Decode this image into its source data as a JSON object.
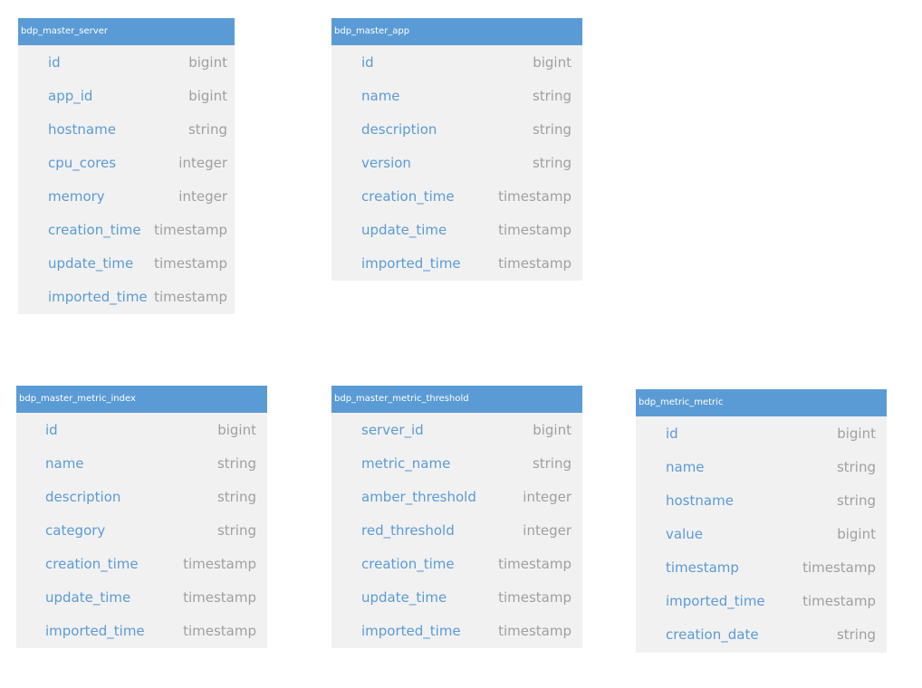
{
  "colors": {
    "header_bg": "#5b9bd5",
    "body_bg": "#f1f1f1",
    "column_name": "#5b9bd5",
    "column_type": "#a0a0a0"
  },
  "tables": [
    {
      "id": "t-server",
      "title": "bdp_master_server",
      "columns": [
        {
          "name": "id",
          "type": "bigint"
        },
        {
          "name": "app_id",
          "type": "bigint"
        },
        {
          "name": "hostname",
          "type": "string"
        },
        {
          "name": "cpu_cores",
          "type": "integer"
        },
        {
          "name": "memory",
          "type": "integer"
        },
        {
          "name": "creation_time",
          "type": "timestamp"
        },
        {
          "name": "update_time",
          "type": "timestamp"
        },
        {
          "name": "imported_time",
          "type": "timestamp"
        }
      ]
    },
    {
      "id": "t-app",
      "title": "bdp_master_app",
      "columns": [
        {
          "name": "id",
          "type": "bigint"
        },
        {
          "name": "name",
          "type": "string"
        },
        {
          "name": "description",
          "type": "string"
        },
        {
          "name": "version",
          "type": "string"
        },
        {
          "name": "creation_time",
          "type": "timestamp"
        },
        {
          "name": "update_time",
          "type": "timestamp"
        },
        {
          "name": "imported_time",
          "type": "timestamp"
        }
      ]
    },
    {
      "id": "t-metric-index",
      "title": "bdp_master_metric_index",
      "columns": [
        {
          "name": "id",
          "type": "bigint"
        },
        {
          "name": "name",
          "type": "string"
        },
        {
          "name": "description",
          "type": "string"
        },
        {
          "name": "category",
          "type": "string"
        },
        {
          "name": "creation_time",
          "type": "timestamp"
        },
        {
          "name": "update_time",
          "type": "timestamp"
        },
        {
          "name": "imported_time",
          "type": "timestamp"
        }
      ]
    },
    {
      "id": "t-threshold",
      "title": "bdp_master_metric_threshold",
      "columns": [
        {
          "name": "server_id",
          "type": "bigint"
        },
        {
          "name": "metric_name",
          "type": "string"
        },
        {
          "name": "amber_threshold",
          "type": "integer"
        },
        {
          "name": "red_threshold",
          "type": "integer"
        },
        {
          "name": "creation_time",
          "type": "timestamp"
        },
        {
          "name": "update_time",
          "type": "timestamp"
        },
        {
          "name": "imported_time",
          "type": "timestamp"
        }
      ]
    },
    {
      "id": "t-metric",
      "title": "bdp_metric_metric",
      "columns": [
        {
          "name": "id",
          "type": "bigint"
        },
        {
          "name": "name",
          "type": "string"
        },
        {
          "name": "hostname",
          "type": "string"
        },
        {
          "name": "value",
          "type": "bigint"
        },
        {
          "name": "timestamp",
          "type": "timestamp"
        },
        {
          "name": "imported_time",
          "type": "timestamp"
        },
        {
          "name": "creation_date",
          "type": "string"
        }
      ]
    }
  ]
}
